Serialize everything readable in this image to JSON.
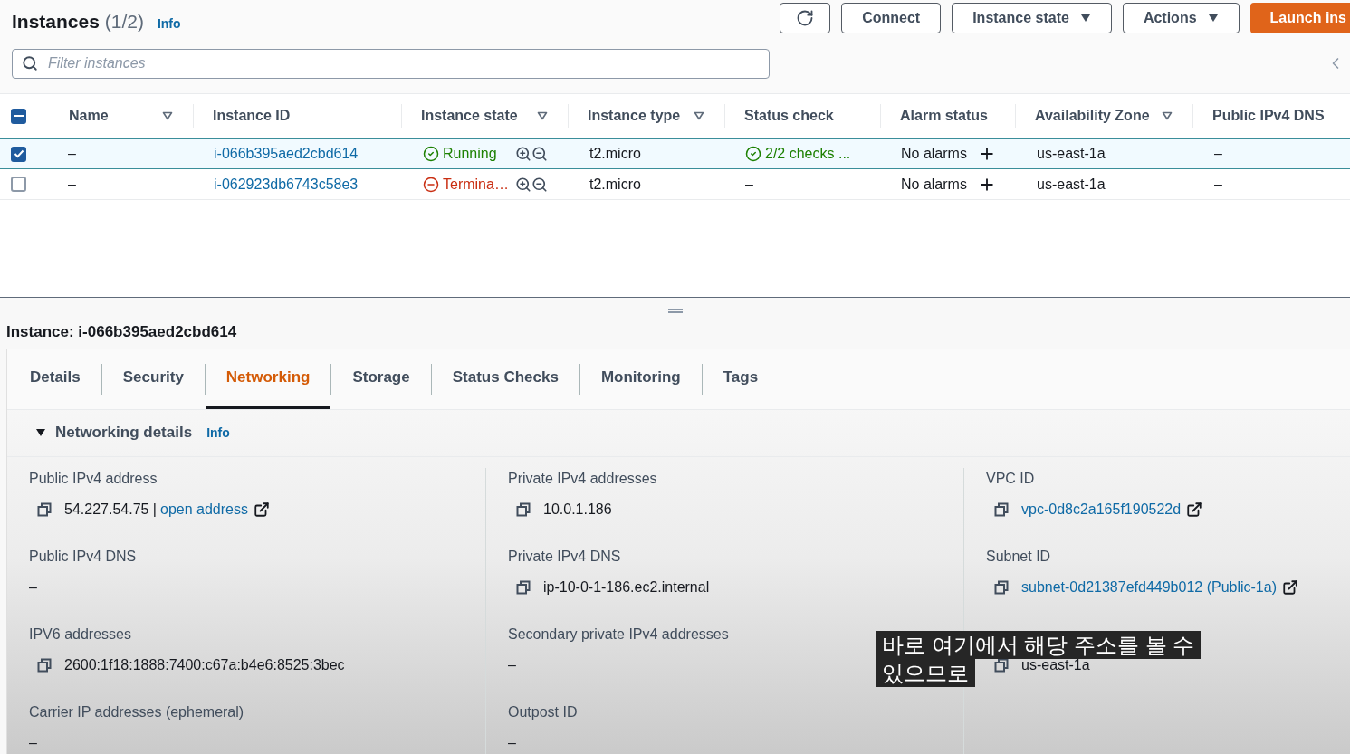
{
  "header": {
    "title": "Instances",
    "count": "(1/2)",
    "info": "Info",
    "buttons": [
      {
        "kind": "refresh"
      },
      {
        "kind": "plain",
        "label": "Connect"
      },
      {
        "kind": "dropdown",
        "label": "Instance state"
      },
      {
        "kind": "dropdown",
        "label": "Actions"
      },
      {
        "kind": "primary",
        "label": "Launch ins"
      }
    ]
  },
  "filter": {
    "placeholder": "Filter instances"
  },
  "table": {
    "select_all": {
      "indeterminate": true
    },
    "columns": [
      {
        "label": "Name",
        "filter": true
      },
      {
        "label": "Instance ID",
        "filter": false
      },
      {
        "label": "Instance state",
        "filter": true
      },
      {
        "label": "Instance type",
        "filter": true
      },
      {
        "label": "Status check",
        "filter": false
      },
      {
        "label": "Alarm status",
        "filter": false
      },
      {
        "label": "Availability Zone",
        "filter": true
      },
      {
        "label": "Public IPv4 DNS",
        "filter": false
      }
    ],
    "rows": [
      {
        "selected": true,
        "name": "–",
        "instance_id": "i-066b395aed2cbd614",
        "state": {
          "kind": "running",
          "label": "Running"
        },
        "type": "t2.micro",
        "status_check": {
          "kind": "ok",
          "text": "2/2 checks ..."
        },
        "alarm": "No alarms",
        "zone": "us-east-1a",
        "public_dns": "–"
      },
      {
        "selected": false,
        "name": "–",
        "instance_id": "i-062923db6743c58e3",
        "state": {
          "kind": "terminated",
          "label": "Termina…"
        },
        "type": "t2.micro",
        "status_check": {
          "kind": "none",
          "text": "–"
        },
        "alarm": "No alarms",
        "zone": "us-east-1a",
        "public_dns": "–"
      }
    ]
  },
  "detail": {
    "title": "Instance: i-066b395aed2cbd614",
    "tabs": [
      {
        "label": "Details",
        "selected": false
      },
      {
        "label": "Security",
        "selected": false
      },
      {
        "label": "Networking",
        "selected": true
      },
      {
        "label": "Storage",
        "selected": false
      },
      {
        "label": "Status Checks",
        "selected": false
      },
      {
        "label": "Monitoring",
        "selected": false
      },
      {
        "label": "Tags",
        "selected": false
      }
    ],
    "section": {
      "title": "Networking details",
      "expanded": true,
      "info": "Info"
    },
    "columns": [
      [
        {
          "kind": "copyable",
          "label": "Public IPv4 address",
          "value": "54.227.54.75 |",
          "extra_link": "open address"
        },
        {
          "kind": "plain",
          "label": "Public IPv4 DNS",
          "value": "–"
        },
        {
          "kind": "copyable",
          "label": "IPV6 addresses",
          "value": "2600:1f18:1888:7400:c67a:b4e6:8525:3bec"
        },
        {
          "kind": "plain",
          "label": "Carrier IP addresses (ephemeral)",
          "value": "–"
        }
      ],
      [
        {
          "kind": "copyable",
          "label": "Private IPv4 addresses",
          "value": "10.0.1.186"
        },
        {
          "kind": "copyable",
          "label": "Private IPv4 DNS",
          "value": "ip-10-0-1-186.ec2.internal"
        },
        {
          "kind": "plain",
          "label": "Secondary private IPv4 addresses",
          "value": "–"
        },
        {
          "kind": "plain",
          "label": "Outpost ID",
          "value": "–"
        }
      ],
      [
        {
          "kind": "link",
          "label": "VPC ID",
          "value": "vpc-0d8c2a165f190522d"
        },
        {
          "kind": "link",
          "label": "Subnet ID",
          "value": "subnet-0d21387efd449b012 (Public-1a)"
        },
        {
          "kind": "copyable",
          "value": "us-east-1a"
        }
      ]
    ]
  },
  "subtitle": {
    "lines": [
      "바로 여기에서 해당 주소를 볼 수",
      "있으므로"
    ]
  }
}
